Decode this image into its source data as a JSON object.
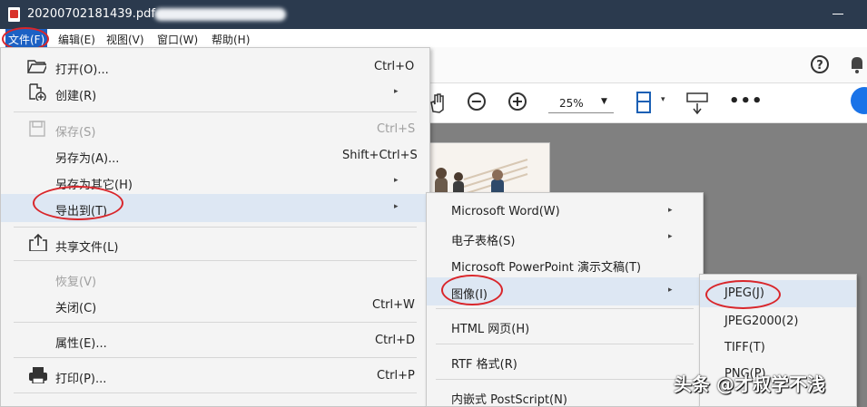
{
  "titlebar": {
    "title": "20200702181439.pdf -"
  },
  "menubar": {
    "items": [
      {
        "label": "文件(F)"
      },
      {
        "label": "编辑(E)"
      },
      {
        "label": "视图(V)"
      },
      {
        "label": "窗口(W)"
      },
      {
        "label": "帮助(H)"
      }
    ]
  },
  "toolbar": {
    "zoom": "25%"
  },
  "file_menu": {
    "open": {
      "label": "打开(O)...",
      "shortcut": "Ctrl+O"
    },
    "create": {
      "label": "创建(R)"
    },
    "save": {
      "label": "保存(S)",
      "shortcut": "Ctrl+S"
    },
    "save_as": {
      "label": "另存为(A)...",
      "shortcut": "Shift+Ctrl+S"
    },
    "save_as_other": {
      "label": "另存为其它(H)"
    },
    "export_to": {
      "label": "导出到(T)"
    },
    "share": {
      "label": "共享文件(L)"
    },
    "revert": {
      "label": "恢复(V)"
    },
    "close": {
      "label": "关闭(C)",
      "shortcut": "Ctrl+W"
    },
    "properties": {
      "label": "属性(E)...",
      "shortcut": "Ctrl+D"
    },
    "print": {
      "label": "打印(P)...",
      "shortcut": "Ctrl+P"
    }
  },
  "export_menu": {
    "word": "Microsoft Word(W)",
    "spreadsheet": "电子表格(S)",
    "powerpoint": "Microsoft PowerPoint 演示文稿(T)",
    "image": "图像(I)",
    "html": "HTML 网页(H)",
    "rtf": "RTF 格式(R)",
    "postscript": "内嵌式 PostScript(N)"
  },
  "image_menu": {
    "jpeg": "JPEG(J)",
    "jpeg2000": "JPEG2000(2)",
    "tiff": "TIFF(T)",
    "png": "PNG(P)"
  },
  "watermark": "头条 @才叔学不浅",
  "colors": {
    "titlebar": "#2b3a4e",
    "menu_active": "#1c61c4",
    "highlight": "#dde7f3",
    "annotation": "#d9262b"
  }
}
